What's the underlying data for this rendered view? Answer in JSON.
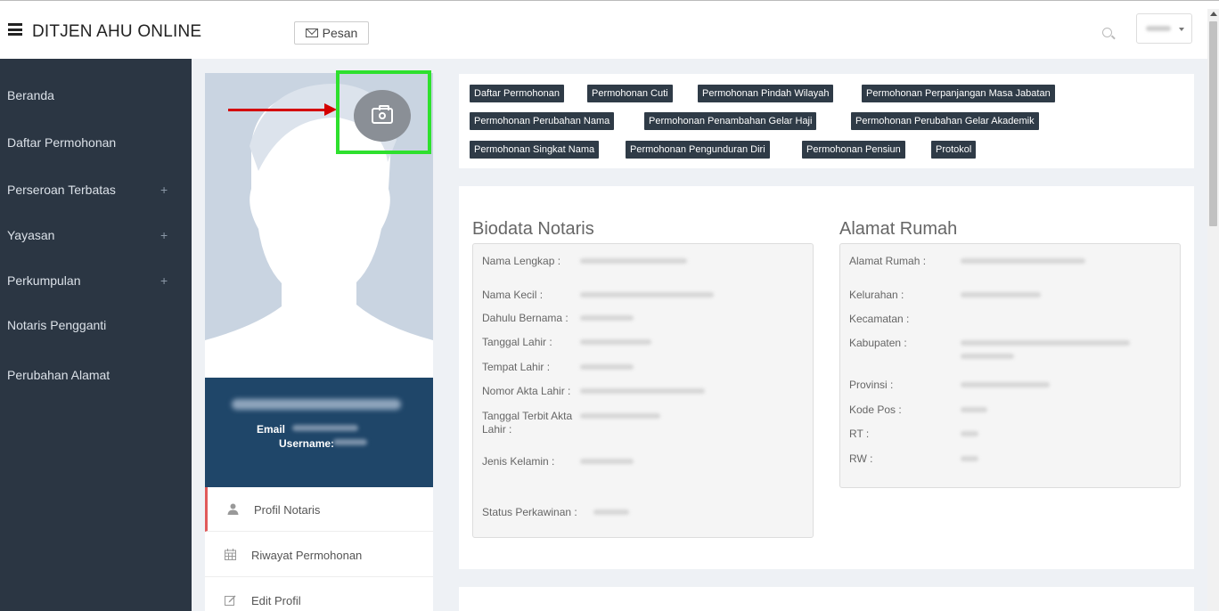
{
  "header": {
    "brand": "DITJEN AHU ONLINE",
    "pesan_label": "Pesan"
  },
  "sidebar": {
    "items": [
      {
        "label": "Beranda"
      },
      {
        "label": "Daftar Permohonan"
      },
      {
        "label": "Perseroan Terbatas",
        "expand": "+"
      },
      {
        "label": "Yayasan",
        "expand": "+"
      },
      {
        "label": "Perkumpulan",
        "expand": "+"
      },
      {
        "label": "Notaris Pengganti"
      },
      {
        "label": "Perubahan Alamat"
      }
    ]
  },
  "profile": {
    "email_label": "Email",
    "username_label": "Username:",
    "menu": [
      {
        "label": "Profil Notaris",
        "icon": "user-icon"
      },
      {
        "label": "Riwayat Permohonan",
        "icon": "calendar-icon"
      },
      {
        "label": "Edit Profil",
        "icon": "edit-icon"
      }
    ]
  },
  "tags": [
    "Daftar Permohonan",
    "Permohonan Cuti",
    "Permohonan Pindah Wilayah",
    "Permohonan Perpanjangan Masa Jabatan",
    "Permohonan Perubahan Nama",
    "Permohonan Penambahan Gelar Haji",
    "Permohonan Perubahan Gelar Akademik",
    "Permohonan Singkat Nama",
    "Permohonan Pengunduran Diri",
    "Permohonan Pensiun",
    "Protokol"
  ],
  "biodata": {
    "title": "Biodata Notaris",
    "fields": [
      {
        "label": "Nama Lengkap :"
      },
      {
        "label": "Nama Kecil :"
      },
      {
        "label": "Dahulu Bernama :"
      },
      {
        "label": "Tanggal Lahir :"
      },
      {
        "label": "Tempat Lahir :"
      },
      {
        "label": "Nomor Akta Lahir :"
      },
      {
        "label": "Tanggal Terbit Akta Lahir :"
      },
      {
        "label": "Jenis Kelamin :"
      },
      {
        "label": "Status Perkawinan :"
      }
    ]
  },
  "alamat": {
    "title": "Alamat Rumah",
    "fields": [
      {
        "label": "Alamat Rumah :"
      },
      {
        "label": "Kelurahan :"
      },
      {
        "label": "Kecamatan :"
      },
      {
        "label": "Kabupaten :"
      },
      {
        "label": "Provinsi :"
      },
      {
        "label": "Kode Pos :"
      },
      {
        "label": "RT :"
      },
      {
        "label": "RW :"
      }
    ]
  },
  "colors": {
    "sidebar_bg": "#2b3643",
    "profile_card_bg": "#1f4669",
    "tag_bg": "#2f3b47",
    "highlight": "#2ee02e",
    "arrow": "#d40000"
  }
}
